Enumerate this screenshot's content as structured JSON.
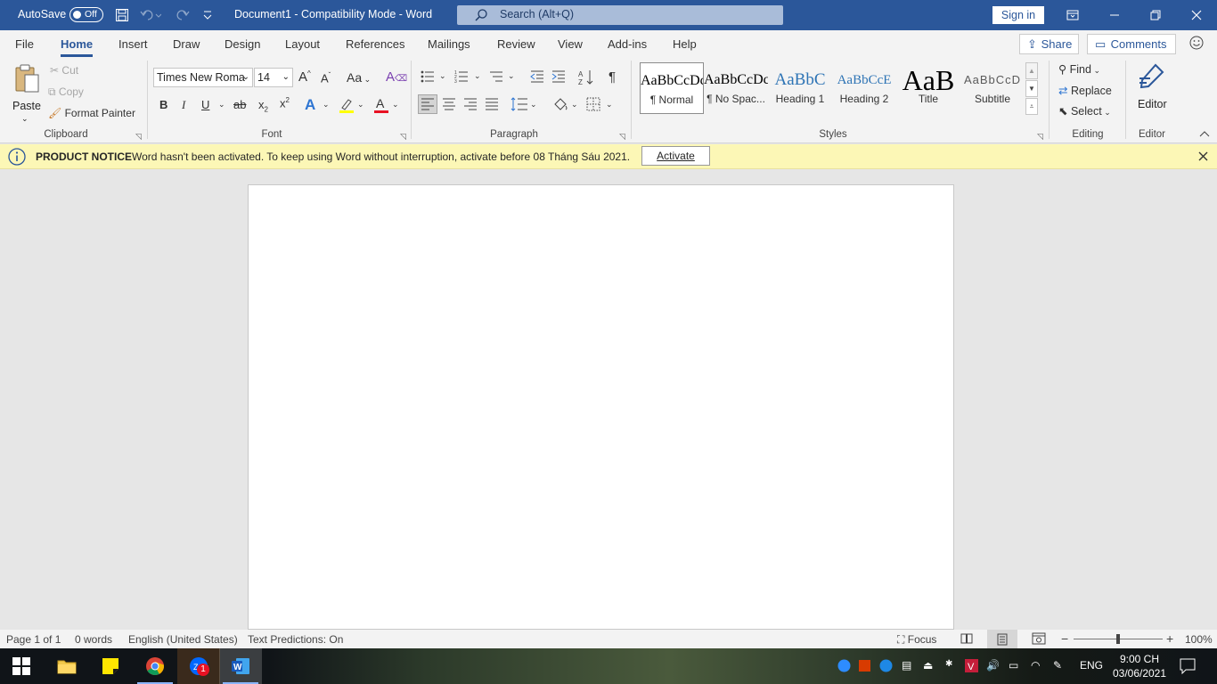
{
  "titlebar": {
    "autosave_label": "AutoSave",
    "autosave_state": "Off",
    "doc_title": "Document1  -  Compatibility Mode  -  Word",
    "search_placeholder": "Search (Alt+Q)",
    "signin_label": "Sign in"
  },
  "tabs": [
    "File",
    "Home",
    "Insert",
    "Draw",
    "Design",
    "Layout",
    "References",
    "Mailings",
    "Review",
    "View",
    "Add-ins",
    "Help"
  ],
  "share_label": "Share",
  "comments_label": "Comments",
  "clipboard": {
    "paste": "Paste",
    "cut": "Cut",
    "copy": "Copy",
    "format_painter": "Format Painter",
    "group": "Clipboard"
  },
  "font": {
    "name": "Times New Roma",
    "size": "14",
    "change_case": "Aa",
    "group": "Font"
  },
  "paragraph": {
    "group": "Paragraph"
  },
  "styles": {
    "items": [
      {
        "preview": "AaBbCcDc",
        "name": "¶ Normal"
      },
      {
        "preview": "AaBbCcDc",
        "name": "¶ No Spac..."
      },
      {
        "preview": "AaBbC",
        "name": "Heading 1"
      },
      {
        "preview": "AaBbCcE",
        "name": "Heading 2"
      },
      {
        "preview": "AaB",
        "name": "Title"
      },
      {
        "preview": "AaBbCcD",
        "name": "Subtitle"
      }
    ],
    "group": "Styles"
  },
  "editing": {
    "find": "Find",
    "replace": "Replace",
    "select": "Select",
    "group": "Editing"
  },
  "editor": {
    "label": "Editor",
    "group": "Editor"
  },
  "notice": {
    "title": "PRODUCT NOTICE",
    "message": "Word hasn't been activated. To keep using Word without interruption, activate before 08 Tháng Sáu 2021.",
    "button": "Activate"
  },
  "status": {
    "page": "Page 1 of 1",
    "words": "0 words",
    "language": "English (United States)",
    "predictions": "Text Predictions: On",
    "focus": "Focus",
    "zoom": "100%",
    "zoom_fraction": 0.5
  },
  "taskbar": {
    "zoom_badge": "1",
    "lang": "ENG",
    "time": "9:00 CH",
    "date": "03/06/2021"
  },
  "colors": {
    "brand": "#2b579a",
    "notice_bg": "#fcf7b6",
    "highlight": "#ffff00",
    "font_color": "#e81123"
  }
}
